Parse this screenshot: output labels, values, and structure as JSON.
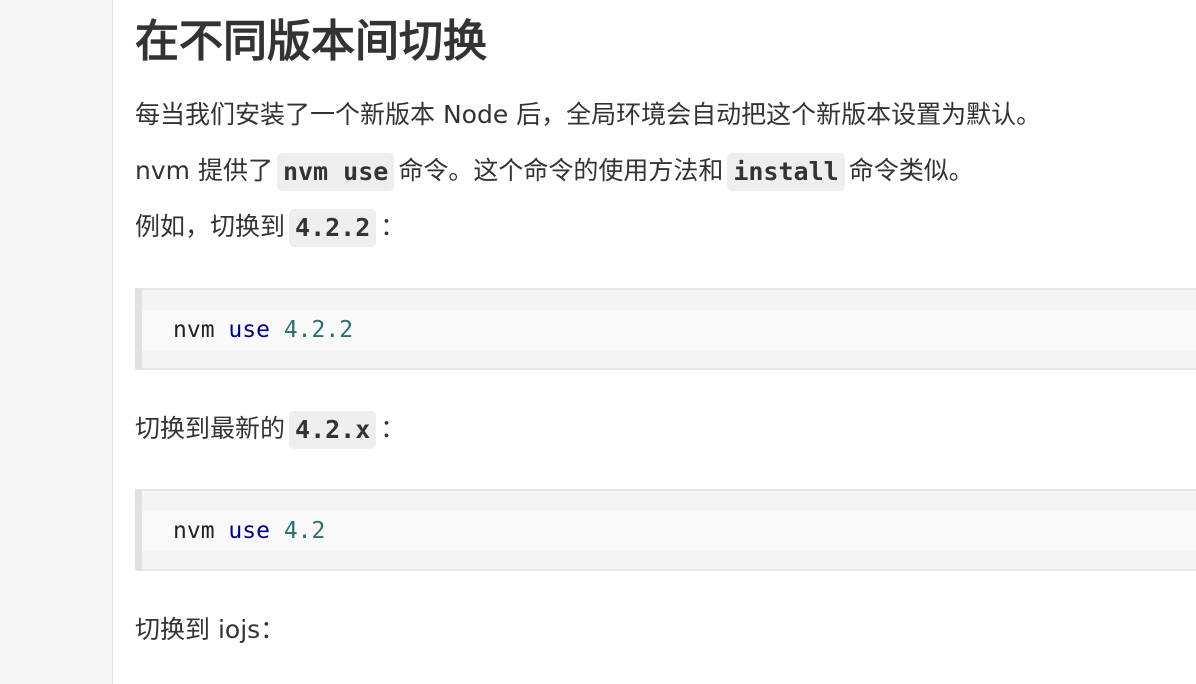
{
  "heading": "在不同版本间切换",
  "para1": "每当我们安装了一个新版本 Node 后，全局环境会自动把这个新版本设置为默认。",
  "para2": {
    "pre": "nvm 提供了",
    "code1": "nvm use",
    "mid": "命令。这个命令的使用方法和",
    "code2": "install",
    "post": "命令类似。"
  },
  "para3": {
    "pre": "例如，切换到",
    "code": "4.2.2",
    "post": "："
  },
  "code_block_1": {
    "cmd": "nvm",
    "kw": "use",
    "arg": "4.2.2"
  },
  "para4": {
    "pre": "切换到最新的",
    "code": "4.2.x",
    "post": "："
  },
  "code_block_2": {
    "cmd": "nvm",
    "kw": "use",
    "arg": "4.2"
  },
  "para5": "切换到 iojs："
}
